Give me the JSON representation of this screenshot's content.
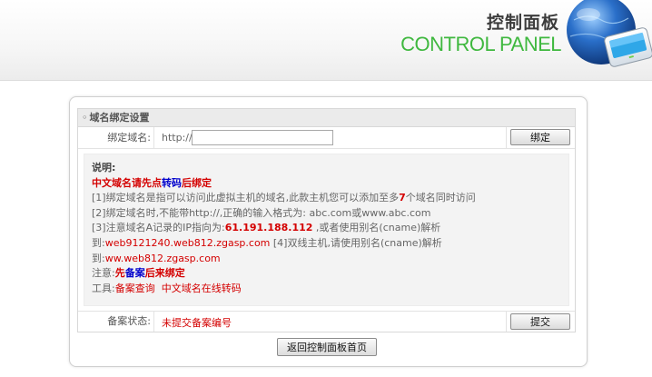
{
  "header": {
    "title_cn": "控制面板",
    "title_en": "CONTROL PANEL"
  },
  "section": {
    "title": "域名绑定设置"
  },
  "domain_row": {
    "label": "绑定域名:",
    "prefix": "http://",
    "input_value": "",
    "bind_button": "绑定"
  },
  "notes": {
    "heading": "说明:",
    "line1": {
      "a": "中文域名请先点",
      "b": "转码",
      "c": "后绑定"
    },
    "line2": {
      "a": "[1]绑定域名是指可以访问此虚拟主机的域名,此款主机您可以添加至多",
      "count": "7",
      "b": "个域名同时访问"
    },
    "line3": "[2]绑定域名时,不能带http://,正确的输入格式为: abc.com或www.abc.com",
    "line4": {
      "a": "[3]注意域名A记录的IP指向为:",
      "ip": "61.191.188.112",
      "b": " ,或者使用别名(cname)解析"
    },
    "line5": {
      "a": "到:",
      "host": "web9121240.web812.zgasp.com",
      "b": " [4]双线主机,请使用别名(cname)解析"
    },
    "line6": {
      "a": "到:",
      "host": "ww.web812.zgasp.com"
    },
    "line7": {
      "a": "注意:",
      "b": "先",
      "c": "备案",
      "d": "后来绑定"
    },
    "line8": {
      "a": "工具:",
      "link1": "备案查询",
      "link2": "中文域名在线转码"
    }
  },
  "beian_row": {
    "label": "备案状态:",
    "value": "未提交备案编号",
    "submit_button": "提交"
  },
  "back_button": "返回控制面板首页",
  "colors": {
    "accent_green": "#3fb83f",
    "highlight_red": "#d40000",
    "highlight_blue": "#0000cc"
  }
}
